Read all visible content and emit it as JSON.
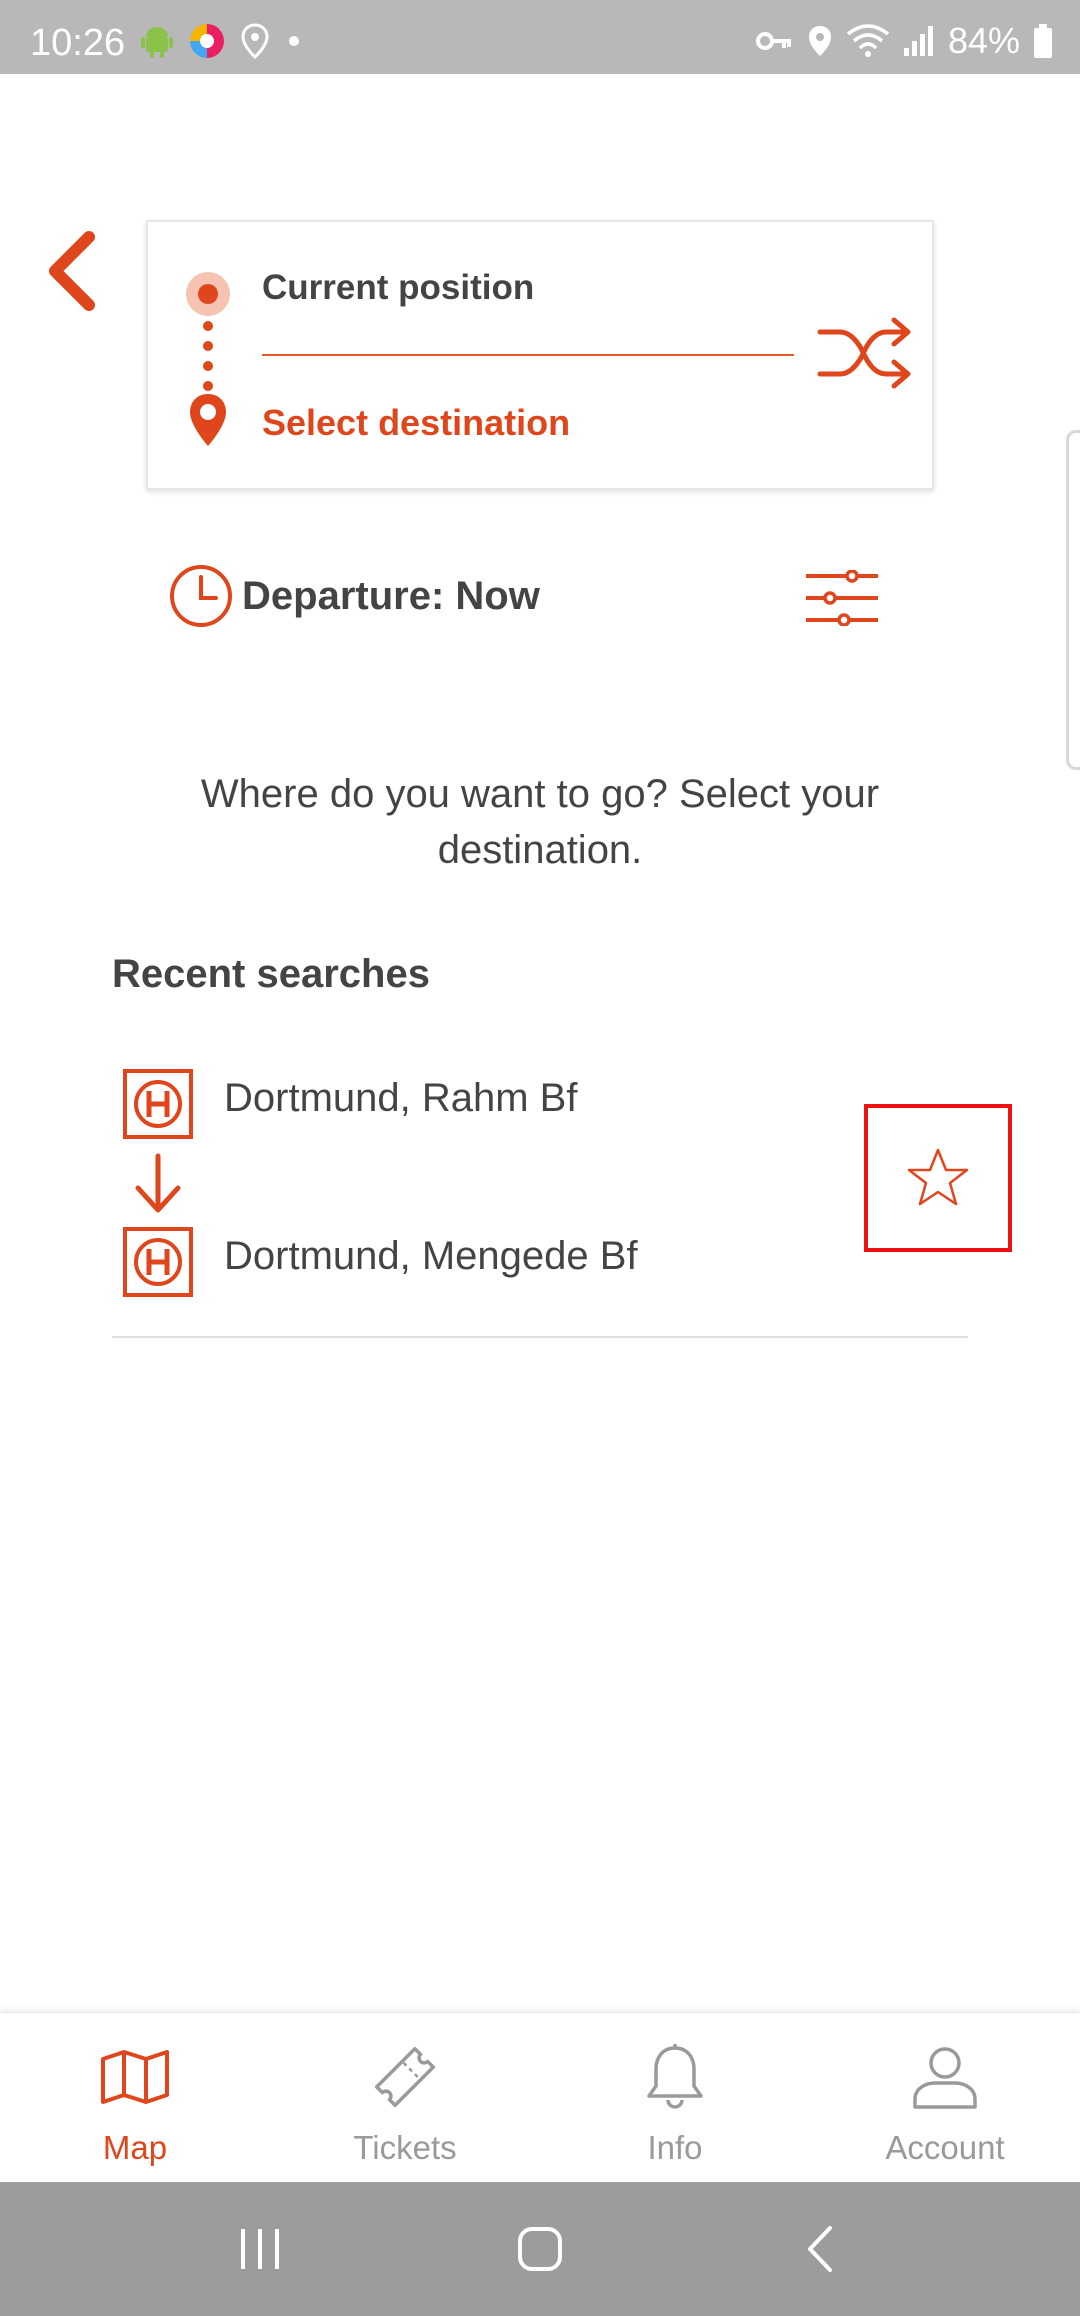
{
  "status_bar": {
    "time": "10:26",
    "battery": "84%",
    "left_icons": [
      "android-icon",
      "colorful-app-icon",
      "location-icon",
      "dot-icon"
    ],
    "right_icons": [
      "vpn-key-icon",
      "location-icon",
      "wifi-icon",
      "signal-icon",
      "battery-icon"
    ]
  },
  "route": {
    "origin_label": "Current position",
    "destination_label": "Select destination"
  },
  "departure": {
    "label": "Departure: Now"
  },
  "prompt_text": "Where do you want to go? Select your destination.",
  "recent": {
    "title": "Recent searches",
    "items": [
      {
        "from": "Dortmund, Rahm Bf",
        "to": "Dortmund, Mengede Bf"
      }
    ]
  },
  "bottom_nav": [
    {
      "label": "Map",
      "icon": "map-icon",
      "active": true
    },
    {
      "label": "Tickets",
      "icon": "ticket-icon",
      "active": false
    },
    {
      "label": "Info",
      "icon": "bell-icon",
      "active": false
    },
    {
      "label": "Account",
      "icon": "user-icon",
      "active": false
    }
  ],
  "colors": {
    "accent": "#e0461c",
    "status_bar": "#b8b8b8",
    "system_nav": "#9c9c9c",
    "highlight_border": "#ee1111"
  }
}
